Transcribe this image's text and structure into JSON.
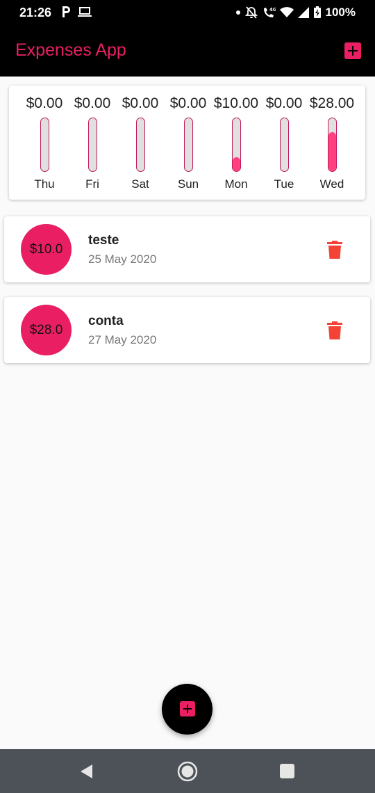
{
  "status_bar": {
    "time": "21:26",
    "battery": "100%",
    "icons": [
      "p-icon",
      "laptop-icon",
      "dot-icon",
      "bell-off-icon",
      "call-4g-icon",
      "wifi-icon",
      "signal-icon",
      "battery-charging-icon"
    ]
  },
  "app_bar": {
    "title": "Expenses App",
    "add_icon": "add-box-icon"
  },
  "chart": {
    "bars": [
      {
        "amount": "$0.00",
        "day": "Thu",
        "fraction": 0
      },
      {
        "amount": "$0.00",
        "day": "Fri",
        "fraction": 0
      },
      {
        "amount": "$0.00",
        "day": "Sat",
        "fraction": 0
      },
      {
        "amount": "$0.00",
        "day": "Sun",
        "fraction": 0
      },
      {
        "amount": "$10.00",
        "day": "Mon",
        "fraction": 0.263
      },
      {
        "amount": "$0.00",
        "day": "Tue",
        "fraction": 0
      },
      {
        "amount": "$28.00",
        "day": "Wed",
        "fraction": 0.737
      }
    ]
  },
  "expenses": [
    {
      "amount": "$10.0",
      "title": "teste",
      "date": "25 May 2020"
    },
    {
      "amount": "$28.0",
      "title": "conta",
      "date": "27 May 2020"
    }
  ],
  "colors": {
    "accent": "#e91e63",
    "bar_fill": "#ff4081",
    "delete": "#f44336",
    "app_bar": "#000000",
    "nav_bar": "#4c5257"
  },
  "fab": {
    "icon": "add-box-icon"
  },
  "nav": {
    "back_icon": "back-icon",
    "home_icon": "home-icon",
    "recents_icon": "recents-icon"
  }
}
